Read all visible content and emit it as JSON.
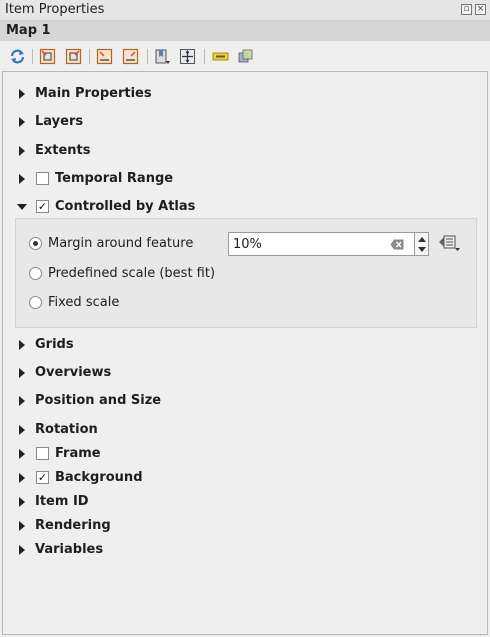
{
  "window": {
    "title": "Item Properties",
    "float_icon": "float-icon",
    "close_icon": "close-icon"
  },
  "item": {
    "name": "Map 1"
  },
  "toolbar": {
    "icons": [
      "refresh-icon",
      "set-extent-to-canvas-icon",
      "view-extent-in-canvas-icon",
      "set-scale-to-canvas-icon",
      "view-scale-in-canvas-icon",
      "bookmarks-icon",
      "interactive-edit-icon",
      "labeling-settings-icon",
      "clipping-settings-icon"
    ]
  },
  "sections": {
    "main_properties": "Main Properties",
    "layers": "Layers",
    "extents": "Extents",
    "temporal_range": {
      "label": "Temporal Range",
      "checked": false
    },
    "controlled_by_atlas": {
      "label": "Controlled by Atlas",
      "checked": true,
      "check_mark": "✓"
    },
    "grids": "Grids",
    "overviews": "Overviews",
    "position_and_size": "Position and Size",
    "rotation": "Rotation",
    "frame": {
      "label": "Frame",
      "checked": false
    },
    "background": {
      "label": "Background",
      "checked": true,
      "check_mark": "✓"
    },
    "item_id": "Item ID",
    "rendering": "Rendering",
    "variables": "Variables"
  },
  "atlas": {
    "margin_label": "Margin around feature",
    "margin_value": "10%",
    "predefined_label": "Predefined scale (best fit)",
    "fixed_label": "Fixed scale",
    "selected": "margin"
  }
}
